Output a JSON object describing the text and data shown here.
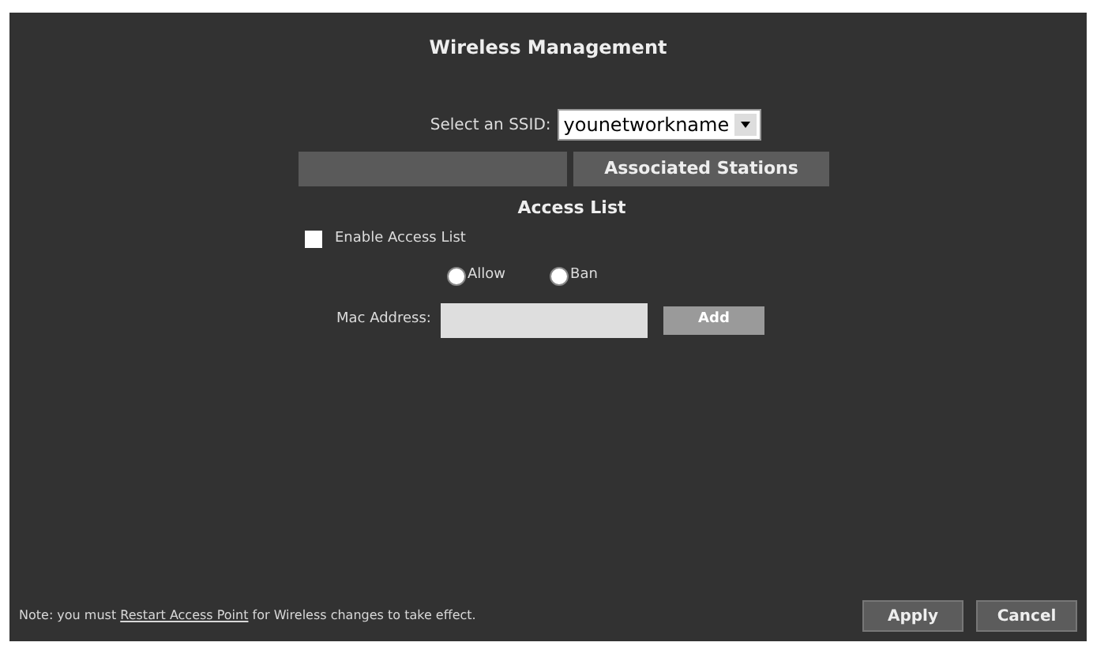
{
  "title": "Wireless Management",
  "ssid": {
    "label": "Select an SSID:",
    "value": "younetworkname"
  },
  "stations_button": "Associated Stations",
  "access_list": {
    "heading": "Access List",
    "enable": {
      "label": "Enable Access List",
      "checked": false
    },
    "modes": [
      {
        "label": "Allow",
        "selected": false
      },
      {
        "label": "Ban",
        "selected": false
      }
    ],
    "mac": {
      "label": "Mac Address:",
      "button": "Add"
    }
  },
  "footer": {
    "note_before": "Note: you must",
    "link": "Restart Access Point",
    "note_after": "for Wireless changes to take effect.",
    "buttons": [
      "Apply",
      "Cancel"
    ]
  }
}
